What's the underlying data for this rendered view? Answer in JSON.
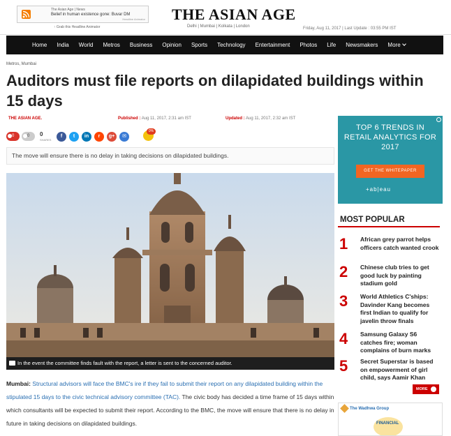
{
  "rss": {
    "feed_name": "The Asian Age | News",
    "headline": "Belief in human existence gone: Buvar DM",
    "powered": "Headline Animator",
    "grab": "↑ Grab this Headline Animator"
  },
  "site": {
    "logo": "THE ASIAN AGE",
    "cities": "Delhi | Mumbai | Kolkata | London",
    "date_line": "Friday, Aug 11, 2017 | Last Update : 03:55 PM IST"
  },
  "nav": {
    "items": [
      "Home",
      "India",
      "World",
      "Metros",
      "Business",
      "Opinion",
      "Sports",
      "Technology",
      "Entertainment",
      "Photos",
      "Life",
      "Newsmakers"
    ],
    "more": "More"
  },
  "article": {
    "breadcrumb": "Metros, Mumbai",
    "title": "Auditors must file reports on dilapidated buildings within 15 days",
    "author": "THE ASIAN AGE.",
    "published_label": "Published :",
    "published_value": "Aug 11, 2017, 2:31 am IST",
    "updated_label": "Updated :",
    "updated_value": "Aug 11, 2017, 2:32 am IST",
    "like_count": "0",
    "dislike_count": "0",
    "shares_count": "0",
    "shares_label": "SHARES",
    "emoji_badge": "0%",
    "summary": "The move will ensure there is no delay in taking decisions on dilapidated buildings.",
    "caption": "In the event the committee finds fault with the report, a letter is sent to the concerned auditor.",
    "body_lead": "Mumbai:",
    "body_intro": "Structural advisors will face the BMC's ire if they fail to submit their report on any dilapidated building within the stipulated 15 days to the civic technical advisory committee (TAC).",
    "body_rest": "The civic body has decided a time frame of 15 days within which consultants will be expected to submit their report. According to the BMC, the move will ensure that there is no delay in future in taking decisions on dilapidated buildings."
  },
  "social_buttons": [
    {
      "name": "facebook",
      "glyph": "f",
      "color": "#3b5998"
    },
    {
      "name": "twitter",
      "glyph": "t",
      "color": "#1da1f2"
    },
    {
      "name": "linkedin",
      "glyph": "in",
      "color": "#0077b5"
    },
    {
      "name": "reddit",
      "glyph": "r",
      "color": "#ff4500"
    },
    {
      "name": "google-plus",
      "glyph": "g+",
      "color": "#dd4b39"
    },
    {
      "name": "email",
      "glyph": "✉",
      "color": "#3a7bd5"
    }
  ],
  "ad": {
    "title": "TOP 6 TRENDS IN RETAIL ANALYTICS FOR 2017",
    "button": "GET THE WHITEPAPER",
    "logo": "+ab|eau"
  },
  "most_popular": {
    "title": "MOST POPULAR",
    "items": [
      {
        "num": "1",
        "text": "African grey parrot helps officers catch wanted crook"
      },
      {
        "num": "2",
        "text": "Chinese club tries to get good luck by painting stadium gold"
      },
      {
        "num": "3",
        "text": "World Athletics C'ships: Davinder Kang becomes first Indian to qualify for javelin throw finals"
      },
      {
        "num": "4",
        "text": "Samsung Galaxy S6 catches fire; woman complains of burn marks"
      },
      {
        "num": "5",
        "text": "Secret Superstar is based on empowerment of girl child, says Aamir Khan"
      }
    ],
    "more": "MORE"
  },
  "ad2": {
    "brand": "The Wadhwa Group",
    "text": "FINANCIAL"
  },
  "colors": {
    "accent_red": "#cc0000",
    "nav_bg": "#111111",
    "ad_teal": "#2a97a5",
    "ad_orange": "#f26522"
  }
}
